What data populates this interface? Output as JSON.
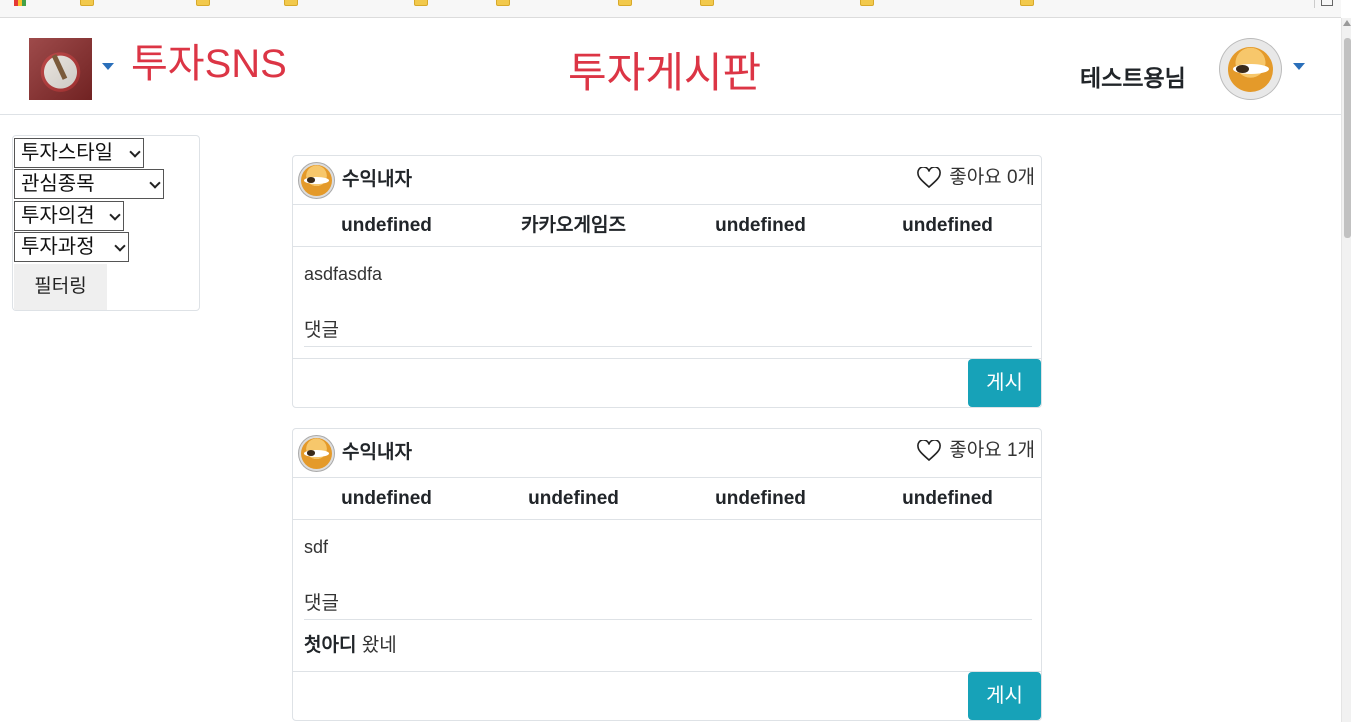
{
  "header": {
    "brand": "투자SNS",
    "page_title": "투자게시판",
    "user_name": "테스트용님"
  },
  "filters": {
    "style_label": "투자스타일",
    "interest_label": "관심종목",
    "opinion_label": "투자의견",
    "process_label": "투자과정",
    "button": "필터링"
  },
  "posts": [
    {
      "author": "수익내자",
      "likes": "좋아요 0개",
      "tags": [
        "undefined",
        "카카오게임즈",
        "undefined",
        "undefined"
      ],
      "body": "asdfasdfa",
      "comments_label": "댓글",
      "comments": [],
      "post_button": "게시"
    },
    {
      "author": "수익내자",
      "likes": "좋아요 1개",
      "tags": [
        "undefined",
        "undefined",
        "undefined",
        "undefined"
      ],
      "body": "sdf",
      "comments_label": "댓글",
      "comments": [
        {
          "user": "첫아디",
          "text": "왔네"
        }
      ],
      "post_button": "게시"
    }
  ],
  "colors": {
    "brand_red": "#dc3545",
    "post_button": "#17a2b8",
    "caret_blue": "#2a6fba"
  }
}
